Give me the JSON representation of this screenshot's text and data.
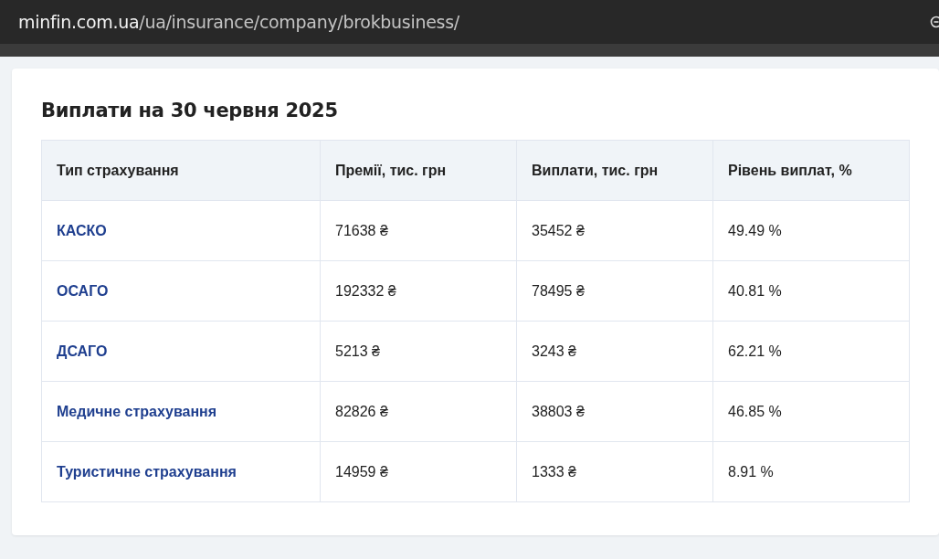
{
  "address_bar": {
    "domain": "minfin.com.ua",
    "path": "/ua/insurance/company/brokbusiness/"
  },
  "section": {
    "title": "Виплати на 30 червня 2025"
  },
  "table": {
    "columns": [
      "Тип страхування",
      "Премії, тис. грн",
      "Виплати, тис. грн",
      "Рівень виплат, %"
    ],
    "rows": [
      {
        "type": "КАСКО",
        "premiums": "71638 ₴",
        "payouts": "35452 ₴",
        "rate": "49.49 %"
      },
      {
        "type": "ОСАГО",
        "premiums": "192332 ₴",
        "payouts": "78495 ₴",
        "rate": "40.81 %"
      },
      {
        "type": "ДСАГО",
        "premiums": "5213 ₴",
        "payouts": "3243 ₴",
        "rate": "62.21 %"
      },
      {
        "type": "Медичне страхування",
        "premiums": "82826 ₴",
        "payouts": "38803 ₴",
        "rate": "46.85 %"
      },
      {
        "type": "Туристичне страхування",
        "premiums": "14959 ₴",
        "payouts": "1333 ₴",
        "rate": "8.91 %"
      }
    ]
  }
}
